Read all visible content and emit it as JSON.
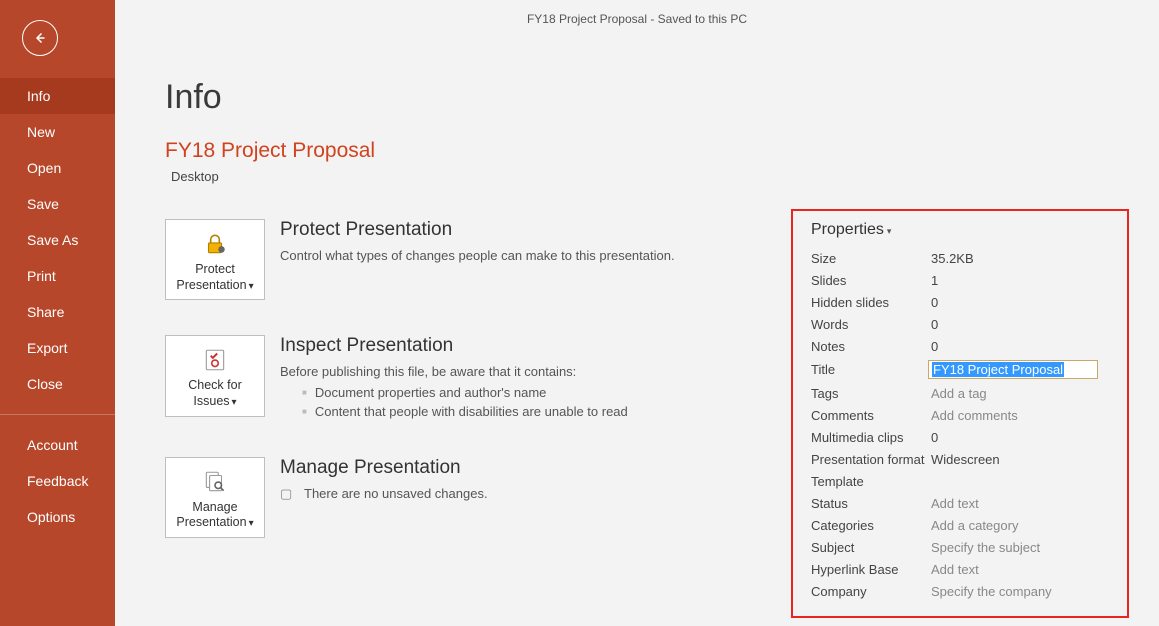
{
  "titlebar": {
    "filename": "FY18 Project Proposal",
    "status": "Saved to this PC",
    "sep": "  -  "
  },
  "nav": {
    "items": [
      {
        "id": "info",
        "label": "Info",
        "active": true
      },
      {
        "id": "new",
        "label": "New"
      },
      {
        "id": "open",
        "label": "Open"
      },
      {
        "id": "save",
        "label": "Save"
      },
      {
        "id": "saveas",
        "label": "Save As"
      },
      {
        "id": "print",
        "label": "Print"
      },
      {
        "id": "share",
        "label": "Share"
      },
      {
        "id": "export",
        "label": "Export"
      },
      {
        "id": "close",
        "label": "Close"
      }
    ],
    "secondary": [
      {
        "id": "account",
        "label": "Account"
      },
      {
        "id": "feedback",
        "label": "Feedback"
      },
      {
        "id": "options",
        "label": "Options"
      }
    ]
  },
  "page": {
    "heading": "Info",
    "doc_title": "FY18 Project Proposal",
    "doc_location": "Desktop"
  },
  "sections": {
    "protect": {
      "button": "Protect Presentation",
      "title": "Protect Presentation",
      "desc": "Control what types of changes people can make to this presentation."
    },
    "inspect": {
      "button": "Check for Issues",
      "title": "Inspect Presentation",
      "desc": "Before publishing this file, be aware that it contains:",
      "bullets": [
        "Document properties and author's name",
        "Content that people with disabilities are unable to read"
      ]
    },
    "manage": {
      "button": "Manage Presentation",
      "title": "Manage Presentation",
      "desc": "There are no unsaved changes."
    }
  },
  "props": {
    "header": "Properties",
    "rows": [
      {
        "label": "Size",
        "value": "35.2KB"
      },
      {
        "label": "Slides",
        "value": "1"
      },
      {
        "label": "Hidden slides",
        "value": "0"
      },
      {
        "label": "Words",
        "value": "0"
      },
      {
        "label": "Notes",
        "value": "0"
      },
      {
        "label": "Title",
        "input": "FY18 Project Proposal"
      },
      {
        "label": "Tags",
        "placeholder": "Add a tag"
      },
      {
        "label": "Comments",
        "placeholder": "Add comments"
      },
      {
        "label": "Multimedia clips",
        "value": "0"
      },
      {
        "label": "Presentation format",
        "value": "Widescreen"
      },
      {
        "label": "Template",
        "value": ""
      },
      {
        "label": "Status",
        "placeholder": "Add text"
      },
      {
        "label": "Categories",
        "placeholder": "Add a category"
      },
      {
        "label": "Subject",
        "placeholder": "Specify the subject"
      },
      {
        "label": "Hyperlink Base",
        "placeholder": "Add text"
      },
      {
        "label": "Company",
        "placeholder": "Specify the company"
      }
    ]
  }
}
